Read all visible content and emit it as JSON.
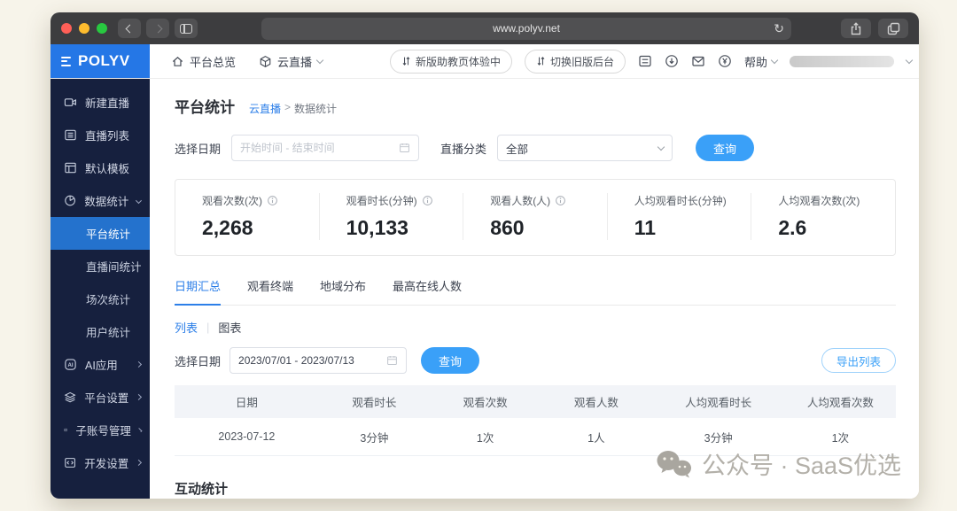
{
  "browser": {
    "url": "www.polyv.net"
  },
  "header": {
    "logo": "POLYV",
    "nav": [
      {
        "label": "平台总览",
        "icon": "home-icon"
      },
      {
        "label": "云直播",
        "icon": "cube-icon"
      }
    ],
    "pills": [
      {
        "label": "新版助教页体验中",
        "icon": "swap-arrows-icon"
      },
      {
        "label": "切换旧版后台",
        "icon": "swap-arrows-icon"
      }
    ],
    "icons": [
      "document-icon",
      "download-circle-icon",
      "mail-icon",
      "yen-circle-icon"
    ],
    "help": "帮助"
  },
  "sidebar": {
    "items": [
      {
        "label": "新建直播",
        "icon": "video-camera-icon"
      },
      {
        "label": "直播列表",
        "icon": "list-icon"
      },
      {
        "label": "默认模板",
        "icon": "template-icon"
      },
      {
        "label": "数据统计",
        "icon": "pie-chart-icon",
        "expanded": true
      },
      {
        "label": "AI应用",
        "icon": "ai-icon"
      },
      {
        "label": "平台设置",
        "icon": "layers-icon"
      },
      {
        "label": "子账号管理",
        "icon": "id-card-icon"
      },
      {
        "label": "开发设置",
        "icon": "code-icon"
      }
    ],
    "subitems": [
      {
        "label": "平台统计",
        "active": true
      },
      {
        "label": "直播间统计",
        "active": false
      },
      {
        "label": "场次统计",
        "active": false
      },
      {
        "label": "用户统计",
        "active": false
      }
    ]
  },
  "page": {
    "title": "平台统计",
    "breadcrumb": {
      "parent": "云直播",
      "separator": ">",
      "current": "数据统计"
    }
  },
  "filters": {
    "date_label": "选择日期",
    "date_placeholder": "开始时间 - 结束时间",
    "category_label": "直播分类",
    "category_value": "全部",
    "search_button": "查询"
  },
  "stats": [
    {
      "label": "观看次数(次)",
      "value": "2,268"
    },
    {
      "label": "观看时长(分钟)",
      "value": "10,133"
    },
    {
      "label": "观看人数(人)",
      "value": "860"
    },
    {
      "label": "人均观看时长(分钟)",
      "value": "11"
    },
    {
      "label": "人均观看次数(次)",
      "value": "2.6"
    }
  ],
  "tabs": [
    {
      "label": "日期汇总",
      "active": true
    },
    {
      "label": "观看终端",
      "active": false
    },
    {
      "label": "地域分布",
      "active": false
    },
    {
      "label": "最高在线人数",
      "active": false
    }
  ],
  "view_toggle": {
    "list": "列表",
    "separator": "|",
    "chart": "图表"
  },
  "date_query": {
    "label": "选择日期",
    "value": "2023/07/01 - 2023/07/13",
    "search_button": "查询",
    "export_button": "导出列表"
  },
  "table": {
    "headers": [
      "日期",
      "观看时长",
      "观看次数",
      "观看人数",
      "人均观看时长",
      "人均观看次数"
    ],
    "rows": [
      [
        "2023-07-12",
        "3分钟",
        "1次",
        "1人",
        "3分钟",
        "1次"
      ]
    ]
  },
  "section": {
    "interaction_title": "互动统计"
  },
  "watermark": {
    "text": "公众号 · SaaS优选"
  },
  "colors": {
    "accent": "#2d7fe8",
    "button_blue": "#3aa0f8",
    "sidebar_bg": "#16203e",
    "logo_bg": "#2577e6"
  }
}
